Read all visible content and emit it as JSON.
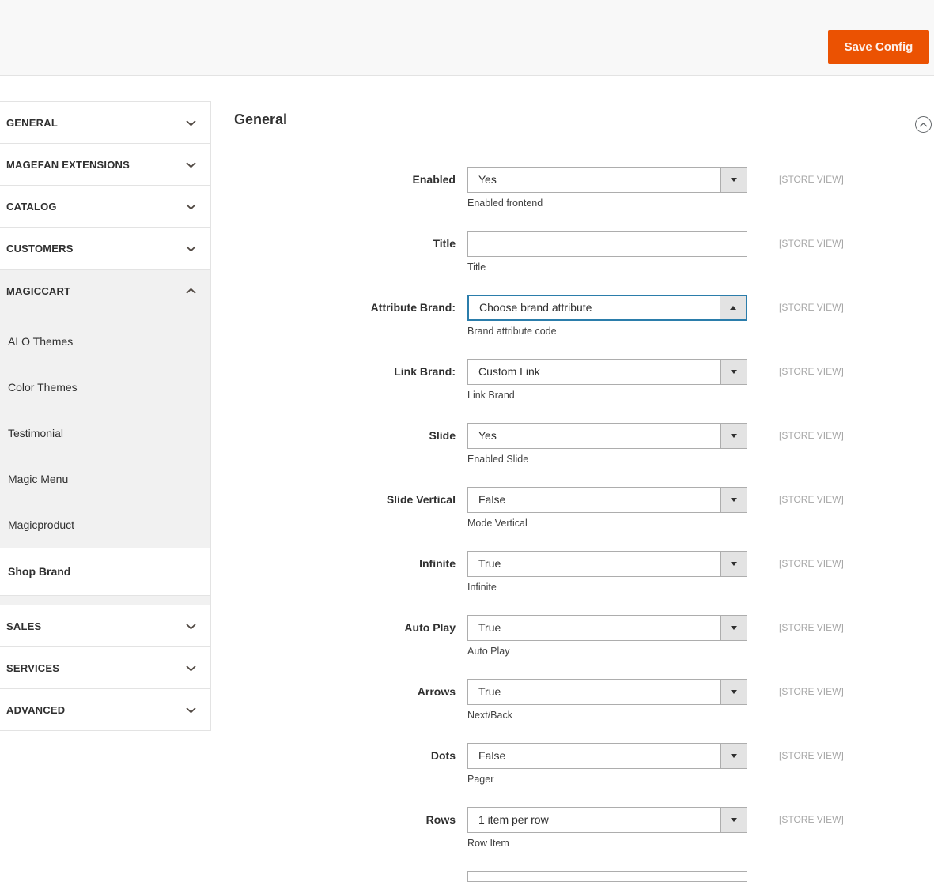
{
  "header": {
    "save_button": "Save Config"
  },
  "colors": {
    "accent": "#eb5202",
    "focus_border": "#2b7dab",
    "scope_text": "#a7a7a7",
    "sidebar_expanded_bg": "#f1f1f1",
    "border": "#e3e3e3",
    "input_border": "#adadad"
  },
  "sidebar": {
    "sections_top": [
      {
        "label": "GENERAL",
        "chevron": "down"
      },
      {
        "label": "MAGEFAN EXTENSIONS",
        "chevron": "down"
      },
      {
        "label": "CATALOG",
        "chevron": "down"
      },
      {
        "label": "CUSTOMERS",
        "chevron": "down"
      }
    ],
    "expanded_section": {
      "label": "MAGICCART",
      "chevron": "up",
      "items": [
        {
          "label": "ALO Themes",
          "selected": false
        },
        {
          "label": "Color Themes",
          "selected": false
        },
        {
          "label": "Testimonial",
          "selected": false
        },
        {
          "label": "Magic Menu",
          "selected": false
        },
        {
          "label": "Magicproduct",
          "selected": false
        },
        {
          "label": "Shop Brand",
          "selected": true
        }
      ]
    },
    "sections_bottom": [
      {
        "label": "SALES",
        "chevron": "down"
      },
      {
        "label": "SERVICES",
        "chevron": "down"
      },
      {
        "label": "ADVANCED",
        "chevron": "down"
      }
    ]
  },
  "main": {
    "section_title": "General",
    "scope_label": "[STORE VIEW]",
    "fields": [
      {
        "label": "Enabled",
        "type": "select",
        "value": "Yes",
        "note": "Enabled frontend",
        "focused": false,
        "open": false
      },
      {
        "label": "Title",
        "type": "text",
        "value": "",
        "note": "Title",
        "focused": false,
        "open": false
      },
      {
        "label": "Attribute Brand:",
        "type": "select",
        "value": "Choose brand attribute",
        "note": "Brand attribute code",
        "focused": true,
        "open": true
      },
      {
        "label": "Link Brand:",
        "type": "select",
        "value": "Custom Link",
        "note": "Link Brand",
        "focused": false,
        "open": false
      },
      {
        "label": "Slide",
        "type": "select",
        "value": "Yes",
        "note": "Enabled Slide",
        "focused": false,
        "open": false
      },
      {
        "label": "Slide Vertical",
        "type": "select",
        "value": "False",
        "note": "Mode Vertical",
        "focused": false,
        "open": false
      },
      {
        "label": "Infinite",
        "type": "select",
        "value": "True",
        "note": "Infinite",
        "focused": false,
        "open": false
      },
      {
        "label": "Auto Play",
        "type": "select",
        "value": "True",
        "note": "Auto Play",
        "focused": false,
        "open": false
      },
      {
        "label": "Arrows",
        "type": "select",
        "value": "True",
        "note": "Next/Back",
        "focused": false,
        "open": false
      },
      {
        "label": "Dots",
        "type": "select",
        "value": "False",
        "note": "Pager",
        "focused": false,
        "open": false
      },
      {
        "label": "Rows",
        "type": "select",
        "value": "1 item per row",
        "note": "Row Item",
        "focused": false,
        "open": false
      }
    ]
  }
}
